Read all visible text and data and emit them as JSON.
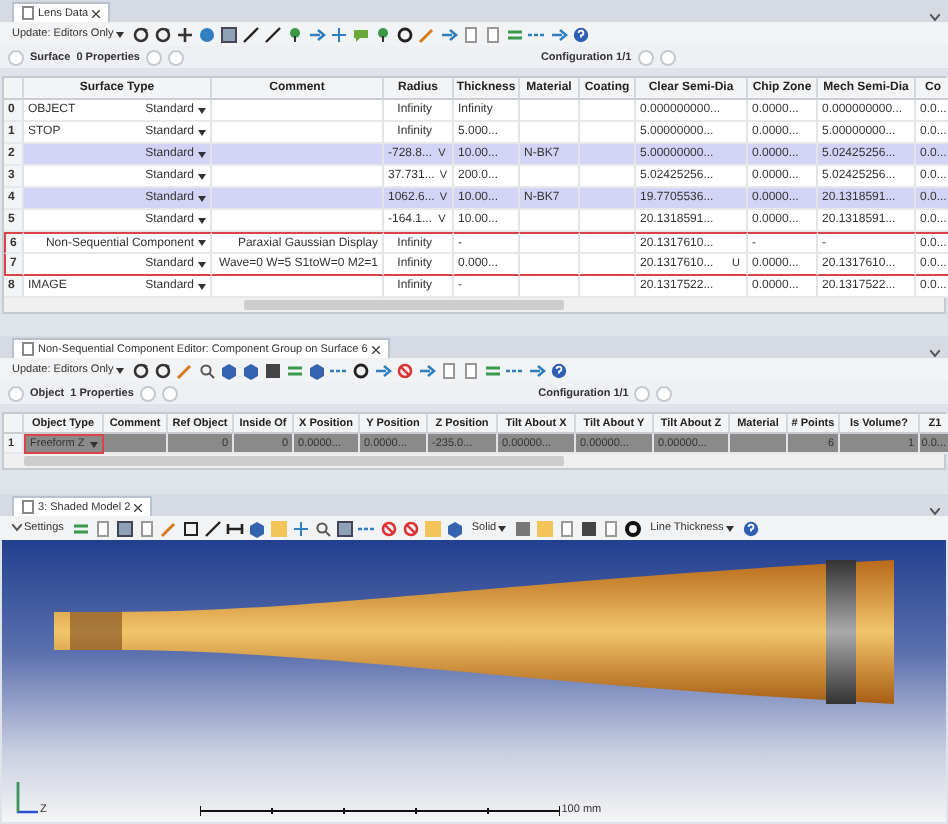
{
  "lens_data": {
    "tab_title": "Lens Data",
    "update": "Update: Editors Only",
    "section": "Surface",
    "properties": "0 Properties",
    "configuration": "Configuration 1/1",
    "columns": [
      "Surface Type",
      "Comment",
      "Radius",
      "Thickness",
      "Material",
      "Coating",
      "Clear Semi-Dia",
      "Chip Zone",
      "Mech Semi-Dia",
      "Co"
    ],
    "rows": [
      {
        "num": "0",
        "name": "OBJECT",
        "type": "Standard",
        "radius": "Infinity",
        "thickness": "Infinity",
        "clear_semi_dia": "0.000000000...",
        "chip_zone": "0.0000...",
        "mech_semi_dia": "0.000000000...",
        "column_co": "0.0...",
        "highlighted": false,
        "outlined": false
      },
      {
        "num": "1",
        "name": "STOP",
        "type": "Standard",
        "radius": "Infinity",
        "thickness": "5.000...",
        "clear_semi_dia": "5.00000000...",
        "chip_zone": "0.0000...",
        "mech_semi_dia": "5.00000000...",
        "column_co": "0.0...",
        "highlighted": false,
        "outlined": false
      },
      {
        "num": "2",
        "type": "Standard",
        "radius": "-728.8...",
        "radius_solve": "V",
        "thickness": "10.00...",
        "material": "N-BK7",
        "clear_semi_dia": "5.00000000...",
        "chip_zone": "0.0000...",
        "mech_semi_dia": "5.02425256...",
        "column_co": "0.0...",
        "highlighted": true,
        "outlined": false
      },
      {
        "num": "3",
        "type": "Standard",
        "radius": "37.731...",
        "radius_solve": "V",
        "thickness": "200.0...",
        "clear_semi_dia": "5.02425256...",
        "chip_zone": "0.0000...",
        "mech_semi_dia": "5.02425256...",
        "column_co": "0.0...",
        "highlighted": false,
        "outlined": false
      },
      {
        "num": "4",
        "type": "Standard",
        "radius": "1062.6...",
        "radius_solve": "V",
        "thickness": "10.00...",
        "material": "N-BK7",
        "clear_semi_dia": "19.7705536...",
        "chip_zone": "0.0000...",
        "mech_semi_dia": "20.1318591...",
        "column_co": "0.0...",
        "highlighted": true,
        "outlined": false
      },
      {
        "num": "5",
        "type": "Standard",
        "radius": "-164.1...",
        "radius_solve": "V",
        "thickness": "10.00...",
        "clear_semi_dia": "20.1318591...",
        "chip_zone": "0.0000...",
        "mech_semi_dia": "20.1318591...",
        "column_co": "0.0...",
        "highlighted": false,
        "outlined": false
      },
      {
        "num": "6",
        "type": "Non-Sequential Component",
        "comment": "Paraxial Gaussian Display",
        "radius": "Infinity",
        "thickness": "-",
        "clear_semi_dia": "20.1317610...",
        "chip_zone": "-",
        "mech_semi_dia": "-",
        "column_co": "0.0...",
        "highlighted": false,
        "outlined": true
      },
      {
        "num": "7",
        "type": "Standard",
        "comment": "Wave=0 W=5 S1toW=0 M2=1",
        "radius": "Infinity",
        "thickness": "0.000...",
        "clear_semi_dia": "20.1317610...",
        "clear_solve": "U",
        "chip_zone": "0.0000...",
        "mech_semi_dia": "20.1317610...",
        "column_co": "0.0...",
        "highlighted": false,
        "outlined": true
      },
      {
        "num": "8",
        "name": "IMAGE",
        "type": "Standard",
        "radius": "Infinity",
        "thickness": "-",
        "clear_semi_dia": "20.1317522...",
        "chip_zone": "0.0000...",
        "mech_semi_dia": "20.1317522...",
        "column_co": "0.0...",
        "highlighted": false,
        "outlined": false
      }
    ]
  },
  "nsc_editor": {
    "tab_title": "Non-Sequential Component Editor: Component Group on Surface 6",
    "update": "Update: Editors Only",
    "section": "Object",
    "properties": "1 Properties",
    "configuration": "Configuration 1/1",
    "columns": [
      "Object Type",
      "Comment",
      "Ref Object",
      "Inside Of",
      "X Position",
      "Y Position",
      "Z Position",
      "Tilt About X",
      "Tilt About Y",
      "Tilt About Z",
      "Material",
      "# Points",
      "Is Volume?",
      "Z1"
    ],
    "rows": [
      {
        "num": "1",
        "cells": [
          "Freeform Z",
          "",
          "0",
          "0",
          "0.0000...",
          "0.0000...",
          "-235.0...",
          "0.00000...",
          "0.00000...",
          "0.00000...",
          "",
          "6",
          "1",
          "0.0..."
        ],
        "selected": true,
        "outlined": true
      }
    ]
  },
  "shaded_model": {
    "tab_title": "3: Shaded Model 2",
    "settings": "Settings",
    "render_mode": "Solid",
    "line_thickness": "Line Thickness",
    "axis_label": "Z",
    "scale_label": "100 mm"
  }
}
